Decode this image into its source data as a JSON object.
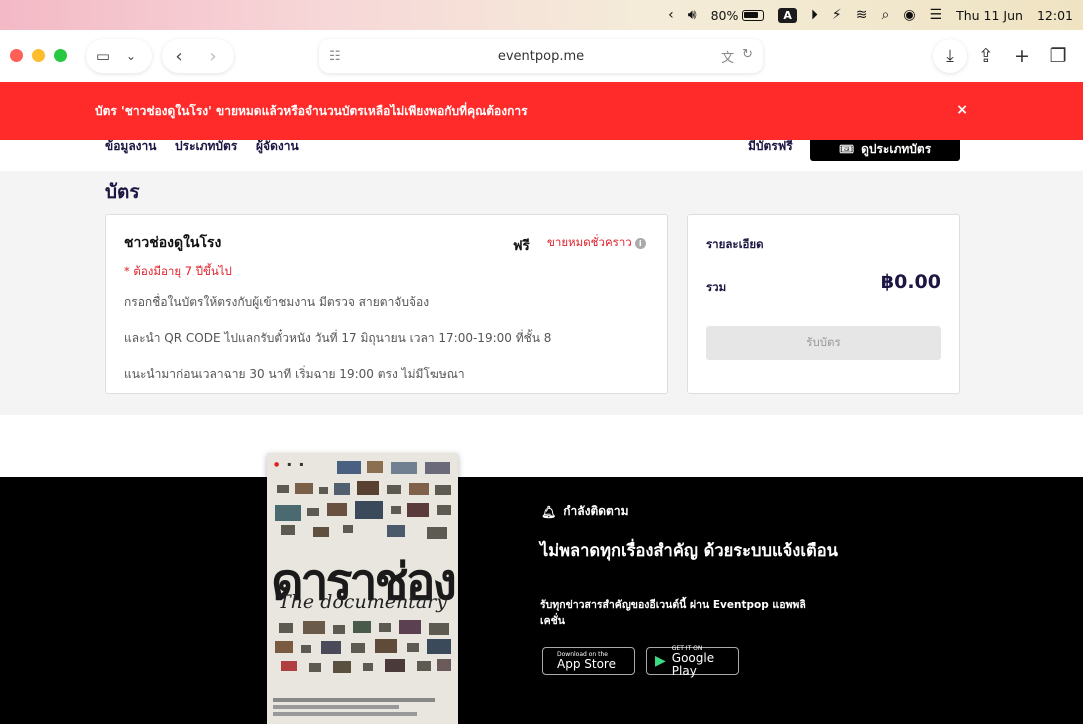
{
  "menubar": {
    "battery_percent": "80%",
    "input_indicator": "A",
    "date": "Thu 11 Jun",
    "time": "12:01"
  },
  "browser": {
    "url": "eventpop.me"
  },
  "alert": {
    "message": "บัตร 'ชาวช่องดูในโรง' ขายหมดแล้วหรือจำนวนบัตรเหลือไม่เพียงพอกับที่คุณต้องการ",
    "close": "×"
  },
  "subnav": {
    "links": [
      "ข้อมูลงาน",
      "ประเภทบัตร",
      "ผู้จัดงาน"
    ],
    "free_label": "มีบัตรฟรี",
    "view_tickets": "ดูประเภทบัตร"
  },
  "tickets": {
    "title": "บัตร",
    "card": {
      "name": "ชาวช่องดูในโรง",
      "price": "ฟรี",
      "status": "ขายหมดชั่วคราว",
      "requirement": "* ต้องมีอายุ 7 ปีขึ้นไป",
      "lines": [
        "กรอกชื่อในบัตรให้ตรงกับผู้เข้าชมงาน มีตรวจ สายตาจับจ้อง",
        "และนำ QR CODE ไปแลกรับตั๋วหนัง วันที่ 17 มิถุนายน เวลา 17:00-19:00 ที่ชั้น 8",
        "แนะนำมาก่อนเวลาฉาย 30 นาที เริ่มฉาย 19:00 ตรง ไม่มีโฆษณา"
      ]
    },
    "summary": {
      "title": "รายละเอียด",
      "total_label": "รวม",
      "total_amount": "฿0.00",
      "button": "รับบัตร"
    }
  },
  "promo": {
    "follow": "กำลังติดตาม",
    "headline": "ไม่พลาดทุกเรื่องสำคัญ ด้วยระบบแจ้งเตือน",
    "body": "รับทุกข่าวสารสำคัญของอีเวนต์นี้ ผ่าน Eventpop แอพพลิเคชั่น",
    "app_store_small": "Download on the",
    "app_store_big": "App Store",
    "google_small": "GET IT ON",
    "google_big": "Google Play"
  },
  "poster": {
    "title": "ดาราช่อง",
    "subtitle": "The documentary"
  },
  "colors": {
    "alert_red": "#ff2b2b",
    "navy": "#1b1642",
    "sold_out_red": "#e0202a"
  }
}
